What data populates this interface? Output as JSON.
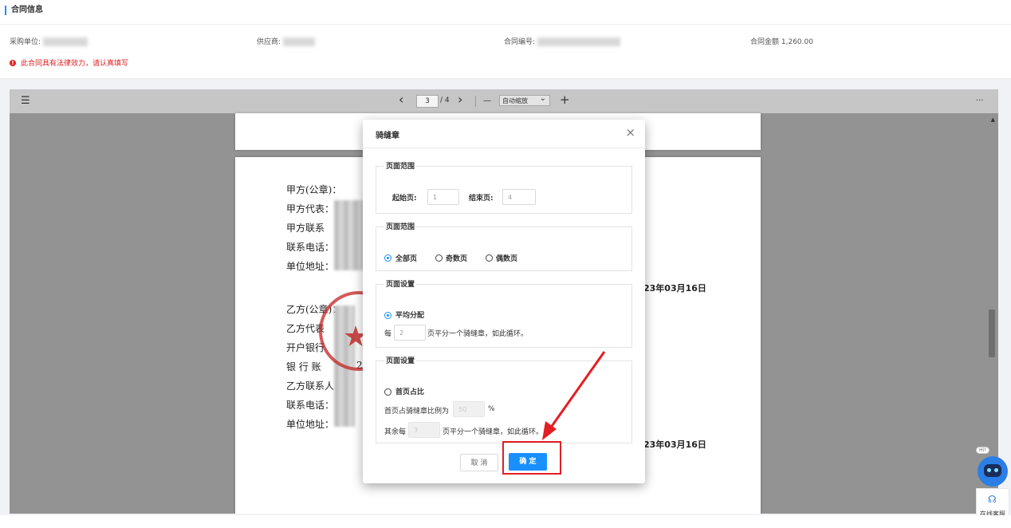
{
  "info": {
    "section_title": "合同信息",
    "buyer_label": "采购单位:",
    "supplier_label": "供应商:",
    "contract_no_label": "合同编号:",
    "amount_label": "合同金额",
    "amount_value": "1,260.00",
    "legal_notice": "此合同具有法律效力，请认真填写"
  },
  "viewer": {
    "toolbar": {
      "menu_icon": "☰",
      "prev": "‹",
      "page_current": "3",
      "page_total": "/ 4",
      "next": "›",
      "zoom_out": "—",
      "zoom_select": "自动缩放",
      "zoom_in": "+",
      "more": "···"
    },
    "page": {
      "party_a": [
        "甲方(公章)：",
        "甲方代表：",
        "甲方联系",
        "联系电话：",
        "单位地址："
      ],
      "party_b": [
        "乙方(公章)：",
        "乙方代表",
        "开户银行",
        "银 行 账",
        "乙方联系人：",
        "联系电话：",
        "单位地址："
      ],
      "date_a": "23年03月16日",
      "date_b": "23年03月16日",
      "acct_fragment": "2"
    }
  },
  "modal": {
    "title": "骑缝章",
    "close": "×",
    "range": {
      "legend": "页面范围",
      "start_label": "起始页:",
      "start_placeholder": "1",
      "end_label": "结束页:",
      "end_placeholder": "4"
    },
    "page_filter": {
      "legend": "页面范围",
      "options": [
        "全部页",
        "奇数页",
        "偶数页"
      ],
      "selected": "全部页"
    },
    "even_dist": {
      "legend": "页面设置",
      "option": "平均分配",
      "every_label": "每",
      "every_value": "2",
      "suffix": "页平分一个骑缝章，如此循环。"
    },
    "first_ratio": {
      "legend": "页面设置",
      "option": "首页占比",
      "ratio_label": "首页占骑缝章比例为",
      "ratio_value": "50",
      "ratio_unit": "%",
      "rest_label": "其余每",
      "rest_value": "3",
      "rest_suffix": "页平分一个骑缝章，如此循环。"
    },
    "cancel": "取 消",
    "confirm": "确 定"
  },
  "assistant": {
    "bubble": "Hi!",
    "service_label": "在线客服"
  },
  "colors": {
    "accent": "#1890ff",
    "danger": "#e02020",
    "annotation": "#e31e24"
  }
}
